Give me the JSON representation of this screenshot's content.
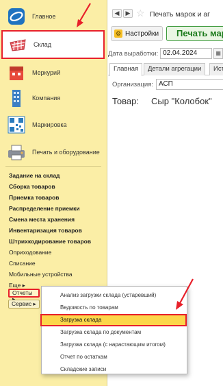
{
  "sidebar": {
    "nav": [
      {
        "label": "Главное",
        "icon": "home-logo-icon"
      },
      {
        "label": "Склад",
        "icon": "warehouse-basket-icon"
      },
      {
        "label": "Меркурий",
        "icon": "mercury-icon"
      },
      {
        "label": "Компания",
        "icon": "company-building-icon"
      },
      {
        "label": "Маркировка",
        "icon": "qr-code-icon"
      },
      {
        "label": "Печать и оборудование",
        "icon": "printer-icon"
      }
    ],
    "menu": [
      {
        "label": "Задание на склад",
        "bold": true
      },
      {
        "label": "Сборка товаров",
        "bold": true
      },
      {
        "label": "Приемка товаров",
        "bold": true
      },
      {
        "label": "Распределение приемки",
        "bold": true
      },
      {
        "label": "Смена места хранения",
        "bold": true
      },
      {
        "label": "Инвентаризация товаров",
        "bold": true
      },
      {
        "label": "Штрихкодирование товаров",
        "bold": true
      },
      {
        "label": "Оприходование",
        "bold": false
      },
      {
        "label": "Списание",
        "bold": false
      },
      {
        "label": "Мобильные устройства",
        "bold": false
      },
      {
        "label": "Еще ▸",
        "bold": false
      }
    ],
    "reports_button": "Отчеты ▸",
    "service_button": "Сервис ▸"
  },
  "main": {
    "title": "Печать марок и аг",
    "back": "◀",
    "forward": "▶",
    "star": "☆",
    "settings_label": "Настройки",
    "print_label": "Печать мар",
    "date_label": "Дата выработки:",
    "date_value": "02.04.2024",
    "cal_icon": "▦",
    "tabs": [
      "Главная",
      "Детали агрегации",
      "Ист"
    ],
    "org_label": "Организация:",
    "org_value": "АСП",
    "product_label": "Товар:",
    "product_value": "Сыр \"Колобок\""
  },
  "popup": {
    "items": [
      {
        "label": "Анализ загрузки склада (устаревший)",
        "selected": false
      },
      {
        "label": "Ведомость по товарам",
        "selected": false
      },
      {
        "label": "Загрузка склада",
        "selected": true
      },
      {
        "label": "Загрузка склада по документам",
        "selected": false
      },
      {
        "label": "Загрузка склада (с нарастающим итогом)",
        "selected": false
      },
      {
        "label": "Отчет по остаткам",
        "selected": false
      },
      {
        "label": "Складские записи",
        "selected": false
      }
    ]
  },
  "colors": {
    "sidebar_bg": "#fbeea6",
    "highlight_red": "#e8202a",
    "selected_item": "#fcd64a",
    "print_green": "#1b7a1b"
  }
}
